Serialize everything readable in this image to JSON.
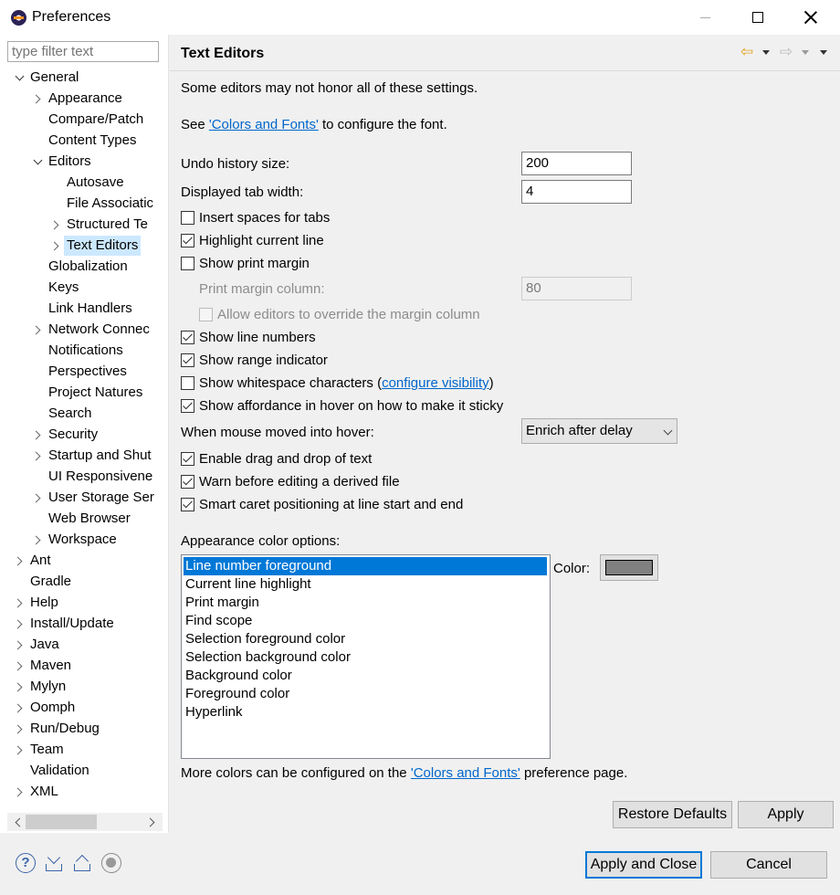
{
  "window": {
    "title": "Preferences"
  },
  "filter": {
    "placeholder": "type filter text"
  },
  "tree": [
    {
      "label": "General",
      "depth": 0,
      "toggle": "open"
    },
    {
      "label": "Appearance",
      "depth": 1,
      "toggle": "closed"
    },
    {
      "label": "Compare/Patch",
      "depth": 1,
      "toggle": "none"
    },
    {
      "label": "Content Types",
      "depth": 1,
      "toggle": "none"
    },
    {
      "label": "Editors",
      "depth": 1,
      "toggle": "open"
    },
    {
      "label": "Autosave",
      "depth": 2,
      "toggle": "none"
    },
    {
      "label": "File Associatic",
      "depth": 2,
      "toggle": "none"
    },
    {
      "label": "Structured Te",
      "depth": 2,
      "toggle": "closed"
    },
    {
      "label": "Text Editors",
      "depth": 2,
      "toggle": "closed",
      "selected": true
    },
    {
      "label": "Globalization",
      "depth": 1,
      "toggle": "none"
    },
    {
      "label": "Keys",
      "depth": 1,
      "toggle": "none"
    },
    {
      "label": "Link Handlers",
      "depth": 1,
      "toggle": "none"
    },
    {
      "label": "Network Connec",
      "depth": 1,
      "toggle": "closed"
    },
    {
      "label": "Notifications",
      "depth": 1,
      "toggle": "none"
    },
    {
      "label": "Perspectives",
      "depth": 1,
      "toggle": "none"
    },
    {
      "label": "Project Natures",
      "depth": 1,
      "toggle": "none"
    },
    {
      "label": "Search",
      "depth": 1,
      "toggle": "none"
    },
    {
      "label": "Security",
      "depth": 1,
      "toggle": "closed"
    },
    {
      "label": "Startup and Shut",
      "depth": 1,
      "toggle": "closed"
    },
    {
      "label": "UI Responsivene",
      "depth": 1,
      "toggle": "none"
    },
    {
      "label": "User Storage Ser",
      "depth": 1,
      "toggle": "closed"
    },
    {
      "label": "Web Browser",
      "depth": 1,
      "toggle": "none"
    },
    {
      "label": "Workspace",
      "depth": 1,
      "toggle": "closed"
    },
    {
      "label": "Ant",
      "depth": 0,
      "toggle": "closed"
    },
    {
      "label": "Gradle",
      "depth": 0,
      "toggle": "none"
    },
    {
      "label": "Help",
      "depth": 0,
      "toggle": "closed"
    },
    {
      "label": "Install/Update",
      "depth": 0,
      "toggle": "closed"
    },
    {
      "label": "Java",
      "depth": 0,
      "toggle": "closed"
    },
    {
      "label": "Maven",
      "depth": 0,
      "toggle": "closed"
    },
    {
      "label": "Mylyn",
      "depth": 0,
      "toggle": "closed"
    },
    {
      "label": "Oomph",
      "depth": 0,
      "toggle": "closed"
    },
    {
      "label": "Run/Debug",
      "depth": 0,
      "toggle": "closed"
    },
    {
      "label": "Team",
      "depth": 0,
      "toggle": "closed"
    },
    {
      "label": "Validation",
      "depth": 0,
      "toggle": "none"
    },
    {
      "label": "XML",
      "depth": 0,
      "toggle": "closed"
    }
  ],
  "page": {
    "title": "Text Editors",
    "note": "Some editors may not honor all of these settings.",
    "see_prefix": "See ",
    "see_link": "'Colors and Fonts'",
    "see_suffix": " to configure the font.",
    "undo_label": "Undo history size:",
    "undo_value": "200",
    "tab_width_label": "Displayed tab width:",
    "tab_width_value": "4",
    "insert_spaces": {
      "label": "Insert spaces for tabs",
      "checked": false
    },
    "highlight_line": {
      "label": "Highlight current line",
      "checked": true
    },
    "print_margin": {
      "label": "Show print margin",
      "checked": false
    },
    "print_margin_column_label": "Print margin column:",
    "print_margin_column_value": "80",
    "allow_override": {
      "label": "Allow editors to override the margin column",
      "checked": false
    },
    "line_numbers": {
      "label": "Show line numbers",
      "checked": true
    },
    "range_indicator": {
      "label": "Show range indicator",
      "checked": true
    },
    "whitespace": {
      "label": "Show whitespace characters (",
      "link": "configure visibility",
      "suffix": ")",
      "checked": false
    },
    "affordance": {
      "label": "Show affordance in hover on how to make it sticky",
      "checked": true
    },
    "hover_label": "When mouse moved into hover:",
    "hover_value": "Enrich after delay",
    "drag_drop": {
      "label": "Enable drag and drop of text",
      "checked": true
    },
    "warn_derived": {
      "label": "Warn before editing a derived file",
      "checked": true
    },
    "smart_caret": {
      "label": "Smart caret positioning at line start and end",
      "checked": true
    },
    "appearance_label": "Appearance color options:",
    "color_options": [
      "Line number foreground",
      "Current line highlight",
      "Print margin",
      "Find scope",
      "Selection foreground color",
      "Selection background color",
      "Background color",
      "Foreground color",
      "Hyperlink"
    ],
    "color_label": "Color:",
    "color_value": "#808080",
    "more_prefix": "More colors can be configured on the ",
    "more_link": "'Colors and Fonts'",
    "more_suffix": " preference page.",
    "restore_defaults": "Restore Defaults",
    "apply": "Apply"
  },
  "footer": {
    "apply_close": "Apply and Close",
    "cancel": "Cancel"
  }
}
